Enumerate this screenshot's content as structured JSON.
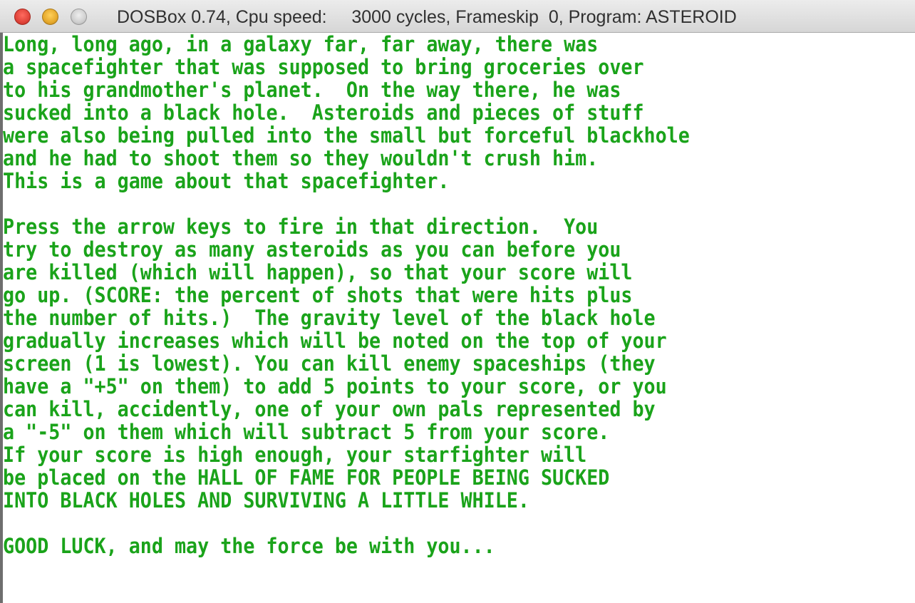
{
  "window": {
    "title": "DOSBox 0.74, Cpu speed:     3000 cycles, Frameskip  0, Program: ASTEROID"
  },
  "screen": {
    "text_color": "#1aa31a",
    "background": "#ffffff",
    "lines": [
      "Long, long ago, in a galaxy far, far away, there was",
      "a spacefighter that was supposed to bring groceries over",
      "to his grandmother's planet.  On the way there, he was",
      "sucked into a black hole.  Asteroids and pieces of stuff",
      "were also being pulled into the small but forceful blackhole",
      "and he had to shoot them so they wouldn't crush him.",
      "This is a game about that spacefighter.",
      "",
      "Press the arrow keys to fire in that direction.  You",
      "try to destroy as many asteroids as you can before you",
      "are killed (which will happen), so that your score will",
      "go up. (SCORE: the percent of shots that were hits plus",
      "the number of hits.)  The gravity level of the black hole",
      "gradually increases which will be noted on the top of your",
      "screen (1 is lowest). You can kill enemy spaceships (they",
      "have a \"+5\" on them) to add 5 points to your score, or you",
      "can kill, accidently, one of your own pals represented by",
      "a \"-5\" on them which will subtract 5 from your score.",
      "If your score is high enough, your starfighter will",
      "be placed on the HALL OF FAME FOR PEOPLE BEING SUCKED",
      "INTO BLACK HOLES AND SURVIVING A LITTLE WHILE.",
      "",
      "GOOD LUCK, and may the force be with you..."
    ]
  }
}
